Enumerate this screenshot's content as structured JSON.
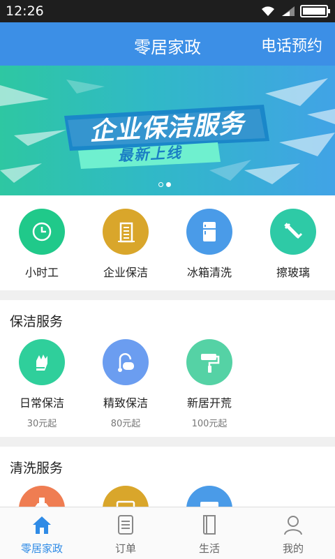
{
  "status_bar": {
    "time": "12:26"
  },
  "header": {
    "title": "零居家政",
    "action": "电话预约"
  },
  "banner": {
    "headline": "企业保洁服务",
    "subline": "最新上线",
    "page_indicator": {
      "count": 2,
      "active_index": 1
    }
  },
  "quick_services": [
    {
      "label": "小时工",
      "icon": "clock-icon",
      "color": "#20c98a"
    },
    {
      "label": "企业保洁",
      "icon": "building-icon",
      "color": "#d9a62b"
    },
    {
      "label": "冰箱清洗",
      "icon": "fridge-icon",
      "color": "#4a9be8"
    },
    {
      "label": "擦玻璃",
      "icon": "squeegee-icon",
      "color": "#2ecaa6"
    }
  ],
  "cleaning_section": {
    "title": "保洁服务",
    "items": [
      {
        "label": "日常保洁",
        "price": "30元起",
        "icon": "gloves-icon",
        "color": "#2fcf9b"
      },
      {
        "label": "精致保洁",
        "price": "80元起",
        "icon": "vacuum-icon",
        "color": "#6b9df0"
      },
      {
        "label": "新居开荒",
        "price": "100元起",
        "icon": "paint-roller-icon",
        "color": "#55d2a5"
      }
    ]
  },
  "washing_section": {
    "title": "清洗服务",
    "items": [
      {
        "icon": "range-hood-icon",
        "color": "#ef7d52"
      },
      {
        "icon": "microwave-icon",
        "color": "#d9a62b"
      },
      {
        "icon": "air-conditioner-icon",
        "color": "#4a9be8"
      }
    ]
  },
  "tab_bar": [
    {
      "label": "零居家政",
      "icon": "home-icon",
      "active": true
    },
    {
      "label": "订单",
      "icon": "order-list-icon",
      "active": false
    },
    {
      "label": "生活",
      "icon": "book-icon",
      "active": false
    },
    {
      "label": "我的",
      "icon": "user-icon",
      "active": false
    }
  ],
  "colors": {
    "header": "#3c8fe6",
    "active_tab": "#2f8be6"
  }
}
